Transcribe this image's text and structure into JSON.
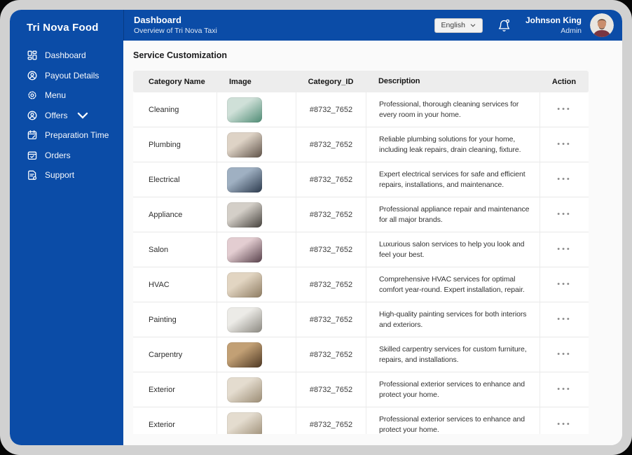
{
  "colors": {
    "brand_blue": "#0B4CA7",
    "bezel_gray": "#D1D1D1",
    "table_header_bg": "#EDEDED"
  },
  "sidebar": {
    "brand": "Tri Nova Food",
    "items": [
      {
        "label": "Dashboard",
        "icon": "dashboard-icon"
      },
      {
        "label": "Payout Details",
        "icon": "payout-details-icon"
      },
      {
        "label": "Menu",
        "icon": "menu-icon"
      },
      {
        "label": "Offers",
        "icon": "offers-icon",
        "has_submenu": true
      },
      {
        "label": "Preparation Time",
        "icon": "preparation-time-icon"
      },
      {
        "label": "Orders",
        "icon": "orders-icon"
      },
      {
        "label": "Support",
        "icon": "support-icon"
      }
    ]
  },
  "header": {
    "title": "Dashboard",
    "subtitle": "Overview of Tri Nova Taxi",
    "language_selector": {
      "value": "English"
    },
    "user": {
      "name": "Johnson King",
      "role": "Admin"
    }
  },
  "main": {
    "section_title": "Service Customization",
    "table": {
      "columns": [
        "Category Name",
        "Image",
        "Category_ID",
        "Description",
        "Action"
      ],
      "action_glyph": "•••",
      "rows": [
        {
          "name": "Cleaning",
          "category_id": "#8732_7652",
          "description": "Professional, thorough cleaning services for every room in your home.",
          "thumb_colors": [
            "#cfe0d8",
            "#4e8b74"
          ]
        },
        {
          "name": "Plumbing",
          "category_id": "#8732_7652",
          "description": "Reliable plumbing solutions for your home, including leak repairs, drain cleaning, fixture.",
          "thumb_colors": [
            "#ded3c6",
            "#5f5248"
          ]
        },
        {
          "name": "Electrical",
          "category_id": "#8732_7652",
          "description": "Expert electrical services for safe and efficient repairs, installations, and maintenance.",
          "thumb_colors": [
            "#9fb0c2",
            "#2c3a4d"
          ]
        },
        {
          "name": "Appliance",
          "category_id": "#8732_7652",
          "description": "Professional appliance repair and maintenance for all major brands.",
          "thumb_colors": [
            "#d4cfc8",
            "#45413c"
          ]
        },
        {
          "name": "Salon",
          "category_id": "#8732_7652",
          "description": "Luxurious salon services to help you look and feel your best.",
          "thumb_colors": [
            "#e3cdd1",
            "#57404a"
          ]
        },
        {
          "name": "HVAC",
          "category_id": "#8732_7652",
          "description": "Comprehensive HVAC services for optimal comfort year-round. Expert installation, repair.",
          "thumb_colors": [
            "#e2d5c2",
            "#8d7b61"
          ]
        },
        {
          "name": "Painting",
          "category_id": "#8732_7652",
          "description": "High-quality painting services for both interiors and exteriors.",
          "thumb_colors": [
            "#ecebe7",
            "#8b8880"
          ]
        },
        {
          "name": "Carpentry",
          "category_id": "#8732_7652",
          "description": "Skilled carpentry services for custom furniture, repairs, and installations.",
          "thumb_colors": [
            "#c2a075",
            "#4e3823"
          ]
        },
        {
          "name": "Exterior",
          "category_id": "#8732_7652",
          "description": "Professional exterior services to enhance and protect your home.",
          "thumb_colors": [
            "#e4dccf",
            "#9b8c74"
          ]
        },
        {
          "name": "Exterior",
          "category_id": "#8732_7652",
          "description": "Professional exterior services to enhance and protect your home.",
          "thumb_colors": [
            "#e4dccf",
            "#9b8c74"
          ]
        }
      ]
    }
  }
}
